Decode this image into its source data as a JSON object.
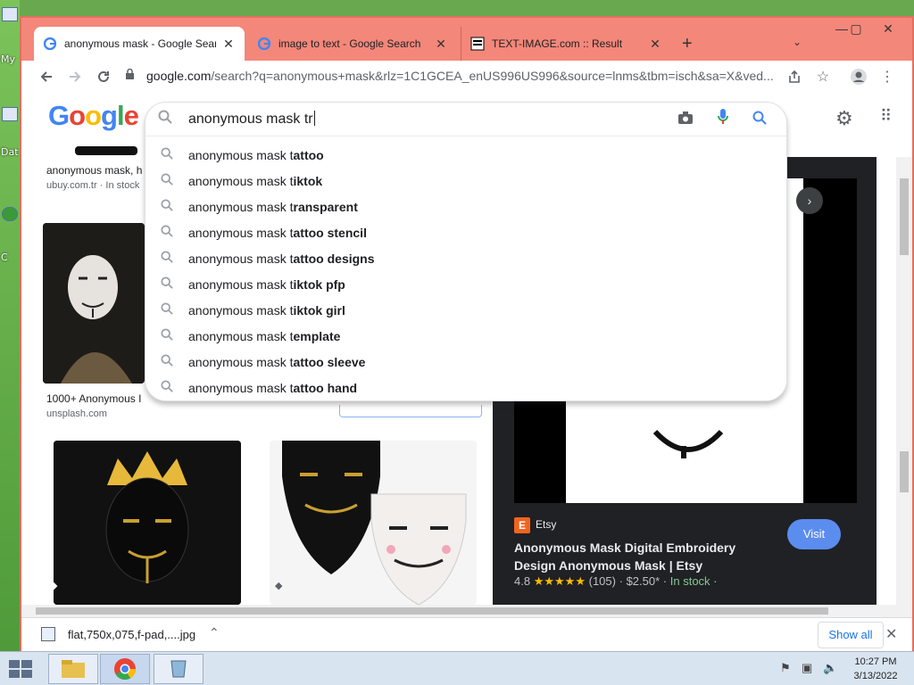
{
  "desktop": {
    "labels": [
      "My",
      "Dat",
      "C"
    ]
  },
  "tabs": [
    {
      "label": "anonymous mask - Google Searc",
      "close": "✕"
    },
    {
      "label": "image to text - Google Search",
      "close": "✕"
    },
    {
      "label": "TEXT-IMAGE.com :: Result",
      "close": "✕"
    }
  ],
  "toolbar": {
    "new_tab": "+",
    "tab_search": "⌄",
    "url_host": "google.com",
    "url_path": "/search?q=anonymous+mask&rlz=1C1GCEA_enUS996US996&source=lnms&tbm=isch&sa=X&ved..."
  },
  "window_controls": {
    "minimize": "—",
    "restore": "▢",
    "close": "✕"
  },
  "google": {
    "logo": [
      {
        "ch": "G",
        "color": "#4285f4"
      },
      {
        "ch": "o",
        "color": "#ea4335"
      },
      {
        "ch": "o",
        "color": "#fbbc05"
      },
      {
        "ch": "g",
        "color": "#4285f4"
      },
      {
        "ch": "l",
        "color": "#34a853"
      },
      {
        "ch": "e",
        "color": "#ea4335"
      }
    ],
    "search_value": "anonymous mask tr",
    "suggestions": [
      {
        "prefix": "anonymous mask t",
        "bold": "attoo"
      },
      {
        "prefix": "anonymous mask t",
        "bold": "iktok"
      },
      {
        "prefix": "anonymous mask t",
        "bold": "ransparent"
      },
      {
        "prefix": "anonymous mask t",
        "bold": "attoo stencil"
      },
      {
        "prefix": "anonymous mask t",
        "bold": "attoo designs"
      },
      {
        "prefix": "anonymous mask t",
        "bold": "iktok pfp"
      },
      {
        "prefix": "anonymous mask t",
        "bold": "iktok girl"
      },
      {
        "prefix": "anonymous mask t",
        "bold": "emplate"
      },
      {
        "prefix": "anonymous mask t",
        "bold": "attoo sleeve"
      },
      {
        "prefix": "anonymous mask t",
        "bold": "attoo hand"
      }
    ]
  },
  "results": {
    "r1": {
      "title": "anonymous mask, h",
      "source": "ubuy.com.tr · In stock"
    },
    "r2": {
      "title": "1000+ Anonymous I",
      "source": "unsplash.com"
    }
  },
  "viewer": {
    "source_name": "Etsy",
    "source_badge": "E",
    "title": "Anonymous Mask Digital Embroidery Design Anonymous Mask | Etsy",
    "rating": "4.8",
    "stars": "★★★★★",
    "reviews": "(105)",
    "price": "$2.50*",
    "stock": "In stock",
    "visit": "Visit"
  },
  "download": {
    "filename": "flat,750x,075,f-pad,....jpg",
    "show_all": "Show all"
  },
  "taskbar": {
    "time": "10:27 PM",
    "date": "3/13/2022"
  }
}
